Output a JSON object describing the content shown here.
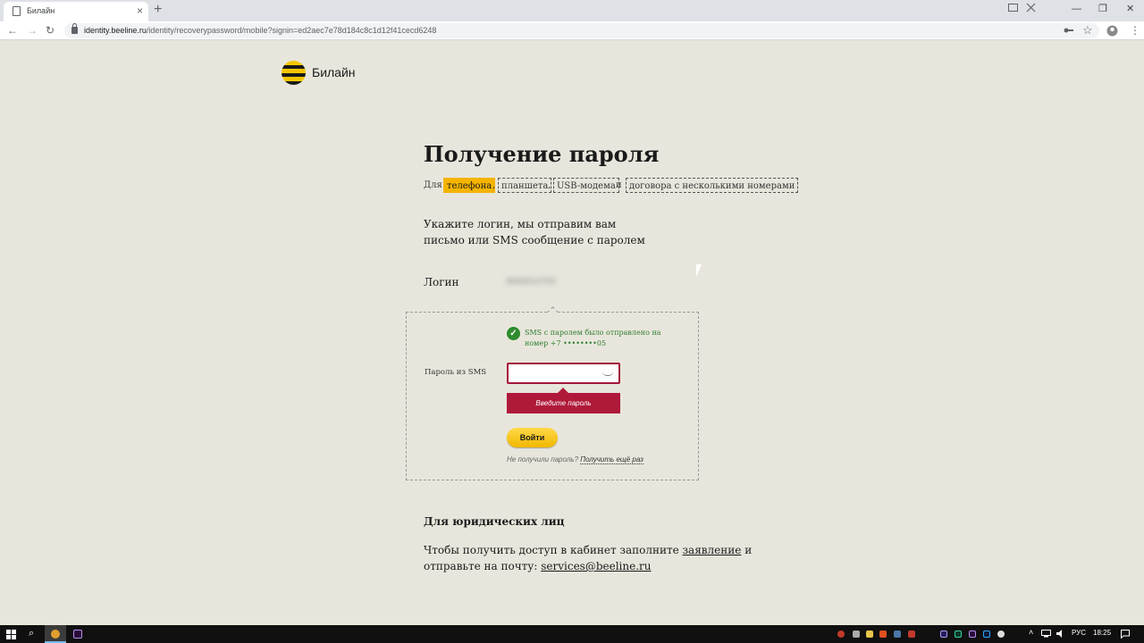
{
  "browser": {
    "tab_title": "Билайн",
    "tab_close": "×",
    "new_tab": "+",
    "url_host": "identity.beeline.ru",
    "url_path": "/identity/recoverypassword/mobile?signin=ed2aec7e78d184c8c1d12f41cecd6248",
    "back": "←",
    "forward": "→",
    "reload": "↻",
    "minimize": "—",
    "maximize": "❐",
    "close": "✕",
    "menu": "⋮",
    "star": "☆"
  },
  "logo": {
    "text": "Билайн"
  },
  "page": {
    "title": "Получение пароля",
    "for_prefix": "Для",
    "for_options": [
      {
        "label": "телефона",
        "active": true
      },
      {
        "label": "планшета",
        "active": false
      },
      {
        "label": "USB-модема",
        "active": false
      },
      {
        "label": "договора с несколькими номерами",
        "active": false
      }
    ],
    "comma": ",",
    "and": "и",
    "description_line1": "Укажите логин, мы отправим вам",
    "description_line2": "письмо или SMS сообщение с паролем",
    "login_label": "Логин",
    "login_value": "9683014703"
  },
  "sms_form": {
    "success_message": "SMS с паролем было отправлено на номер +7 ••••••••05",
    "password_label": "Пароль из SMS",
    "password_value": "",
    "error_text": "Введите пароль",
    "submit_label": "Войти",
    "resend_prefix": "Не получили пароль?",
    "resend_link": "Получить ещё раз"
  },
  "legal": {
    "title": "Для юридических лиц",
    "line1_prefix": "Чтобы получить доступ в кабинет заполните",
    "line1_link": "заявление",
    "line1_suffix": "и",
    "line2_prefix": "отправьте на почту:",
    "line2_link": "services@beeline.ru"
  },
  "taskbar": {
    "lang": "РУС",
    "time": "18:25"
  },
  "colors": {
    "background": "#e8e6dc",
    "accent_yellow": "#f5b400",
    "error_red": "#b01a3a",
    "success_green": "#2e8b2e"
  }
}
